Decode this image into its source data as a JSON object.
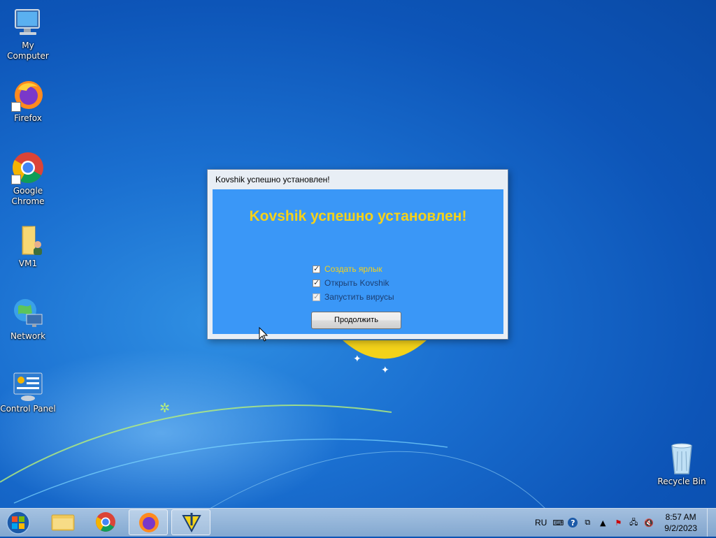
{
  "desktop": {
    "icons": [
      {
        "label": "My Computer"
      },
      {
        "label": "Firefox"
      },
      {
        "label": "Google Chrome"
      },
      {
        "label": "VM1"
      },
      {
        "label": "Network"
      },
      {
        "label": "Control Panel"
      },
      {
        "label": "Recycle Bin"
      }
    ]
  },
  "dialog": {
    "title": "Kovshik успешно установлен!",
    "heading": "Kovshik успешно установлен!",
    "heading_color": "#f5d21a",
    "body_color": "#3a97f7",
    "options": [
      {
        "label": "Создать ярлык",
        "checked": true,
        "color": "#f5d21a"
      },
      {
        "label": "Открыть Kovshik",
        "checked": true,
        "color": "#1c3f73"
      },
      {
        "label": "Запустить вирусы",
        "checked": true,
        "color": "#1c3f73",
        "disabled": true
      }
    ],
    "continue_label": "Продолжить"
  },
  "taskbar": {
    "pinned": [
      "start-orb-icon",
      "file-explorer-icon",
      "chrome-icon",
      "firefox-icon",
      "installer-icon"
    ],
    "tray": {
      "language": "RU",
      "time": "8:57 AM",
      "date": "9/2/2023"
    }
  }
}
